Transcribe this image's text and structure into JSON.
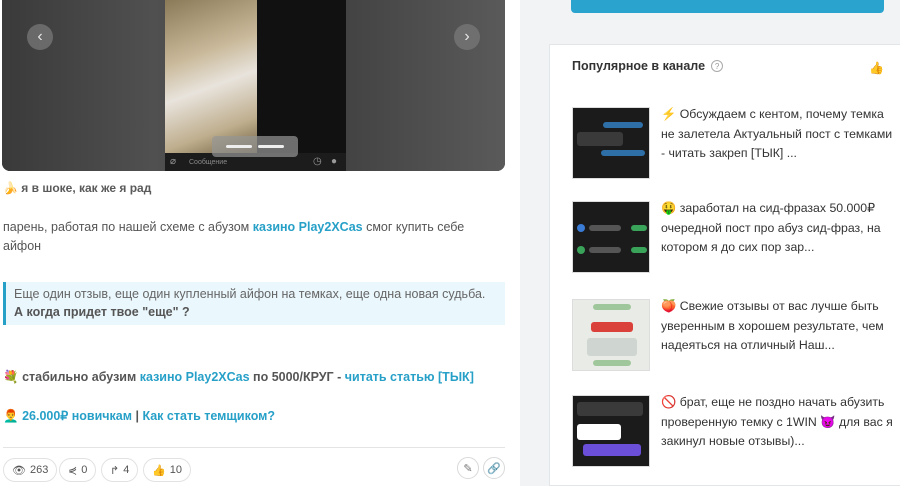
{
  "media": {
    "chat_placeholder": "Сообщение",
    "prev_icon": "chevron-left-icon",
    "next_icon": "chevron-right-icon"
  },
  "post": {
    "caption": "🍌 я в шоке, как же я рад",
    "body_pre": "парень, работая по нашей схеме с абузом ",
    "body_link": "казино Play2XCas",
    "body_post": " смог купить себе айфон",
    "quote_plain": "Еще один отзыв, еще один купленный айфон на темках, еще одна новая судьба. ",
    "quote_bold": "А когда придет твое \"еще\" ?",
    "line1_emoji": "💐",
    "line1_pre": "стабильно абузим ",
    "line1_link": "казино Play2XCas",
    "line1_mid": " по 5000/КРУГ - ",
    "line1_link2": "читать статью [ТЫК]",
    "line2_emoji": "👨‍🦰",
    "line2_link": "26.000₽ новичкам",
    "line2_sep": " | ",
    "line2_link2": "Как стать темщиком?"
  },
  "stats": {
    "views": "263",
    "shares": "0",
    "forwards": "4",
    "likes": "10"
  },
  "sidebar": {
    "title": "Популярное в канале",
    "items": [
      {
        "text": "⚡ Обсуждаем с кентом, почему темка не залетела Актуальный пост с темками - читать закреп [ТЫК] ..."
      },
      {
        "text": "🤑 заработал на сид-фразах 50.000₽ очередной пост про абуз сид-фраз, на котором я до сих пор зар..."
      },
      {
        "text": "🍑 Свежие отзывы от вас лучше быть уверенным в хорошем результате, чем надеяться на отличный Наш..."
      },
      {
        "text": "🚫 брат, еще не поздно начать абузить проверенную темку с 1WIN 😈 для вас я закинул новые отзывы)..."
      }
    ]
  },
  "colors": {
    "accent": "#27a0c8",
    "button": "#2aa3cf",
    "sidebar_bg": "#f1f3f5"
  }
}
